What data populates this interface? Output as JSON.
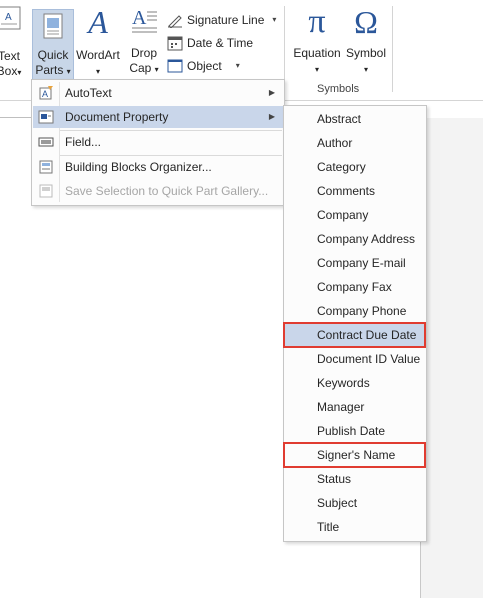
{
  "ribbon": {
    "text_box": {
      "line1": "Text",
      "line2": "Box"
    },
    "quick_parts": {
      "line1": "Quick",
      "line2": "Parts"
    },
    "wordart": {
      "label": "WordArt"
    },
    "drop_cap": {
      "line1": "Drop",
      "line2": "Cap"
    },
    "signature_line": "Signature Line",
    "date_time": "Date & Time",
    "object": "Object",
    "equation": "Equation",
    "symbol": "Symbol",
    "symbols_group": "Symbols",
    "pi_glyph": "π",
    "omega_glyph": "Ω",
    "wordart_glyph": "A"
  },
  "quick_parts_menu": {
    "items": [
      {
        "label": "AutoText",
        "icon": "autotext-icon",
        "submenu": true
      },
      {
        "label": "Document Property",
        "icon": "document-property-icon",
        "submenu": true
      },
      {
        "label": "Field...",
        "icon": "field-icon",
        "submenu": false
      },
      {
        "label": "Building Blocks Organizer...",
        "icon": "building-blocks-icon",
        "submenu": false
      },
      {
        "label": "Save Selection to Quick Part Gallery...",
        "icon": "save-selection-icon",
        "submenu": false
      }
    ]
  },
  "document_property_menu": {
    "items": [
      "Abstract",
      "Author",
      "Category",
      "Comments",
      "Company",
      "Company Address",
      "Company E-mail",
      "Company Fax",
      "Company Phone",
      "Contract Due Date",
      "Document ID Value",
      "Keywords",
      "Manager",
      "Publish Date",
      "Signer's Name",
      "Status",
      "Subject",
      "Title"
    ]
  },
  "colors": {
    "highlight_box": "#e03c31",
    "menu_hover": "#c9d6ea",
    "ribbon_active": "#c8d6e8",
    "icon_blue": "#2b579a"
  }
}
